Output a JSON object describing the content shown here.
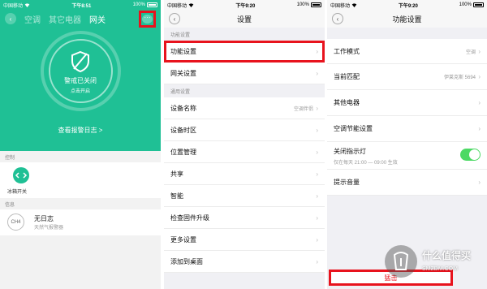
{
  "status": {
    "carrier": "中国移动",
    "time1": "下午8:51",
    "time2": "下午9:20",
    "time3": "下午9:20",
    "battery": "100%"
  },
  "screen1": {
    "tabs": [
      "空调",
      "其它电器",
      "网关"
    ],
    "more_icon": "···",
    "alarm_title": "警戒已关闭",
    "alarm_sub": "点击开启",
    "log_link": "查看报警日志 >",
    "control_label": "控制",
    "fridge_label": "冰箱开关",
    "info_label": "信息",
    "log_badge": "CH4",
    "log_title": "无日志",
    "log_subtitle": "天然气报警器"
  },
  "screen2": {
    "title": "设置",
    "group1_label": "功能设置",
    "group1": [
      {
        "label": "功能设置",
        "value": ""
      },
      {
        "label": "网关设置",
        "value": ""
      }
    ],
    "group2_label": "通用设置",
    "group2": [
      {
        "label": "设备名称",
        "value": "空调伴侣"
      },
      {
        "label": "设备时区",
        "value": ""
      },
      {
        "label": "位置管理",
        "value": ""
      },
      {
        "label": "共享",
        "value": ""
      },
      {
        "label": "智能",
        "value": ""
      },
      {
        "label": "检查固件升级",
        "value": ""
      },
      {
        "label": "更多设置",
        "value": ""
      },
      {
        "label": "添加到桌面",
        "value": ""
      }
    ]
  },
  "screen3": {
    "title": "功能设置",
    "rows": [
      {
        "label": "工作模式",
        "value": "空调"
      },
      {
        "label": "当前匹配",
        "value": "伊莱克斯 5694"
      },
      {
        "label": "其他电器",
        "value": ""
      },
      {
        "label": "空调节能设置",
        "value": ""
      }
    ],
    "indicator_label": "关闭指示灯",
    "indicator_sub": "仅在每天 21:00 — 09:00 生效",
    "sound_label": "提示音量",
    "remove_label": "猛击"
  },
  "watermark": {
    "text": "什么值得买",
    "url": "SMZDM.COM"
  },
  "colors": {
    "accent_green": "#1fc095",
    "highlight_red": "#e8131d",
    "toggle_on": "#4cd964"
  }
}
